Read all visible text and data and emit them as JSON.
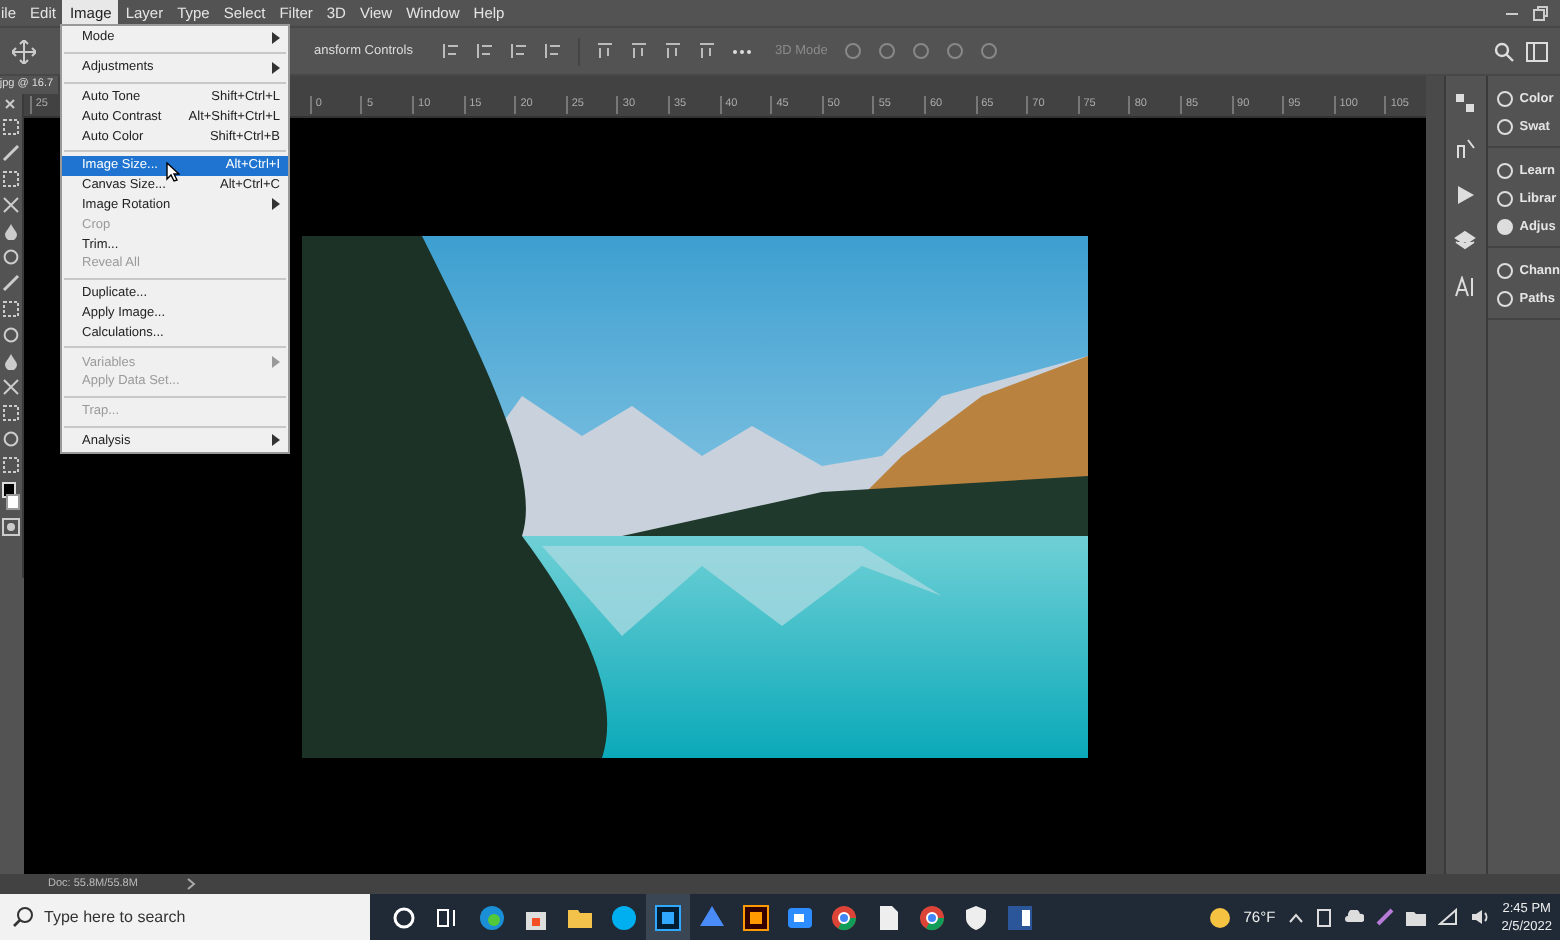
{
  "menubar": [
    {
      "label": "ile",
      "selected": false
    },
    {
      "label": "Edit",
      "selected": false
    },
    {
      "label": "Image",
      "selected": true
    },
    {
      "label": "Layer",
      "selected": false
    },
    {
      "label": "Type",
      "selected": false
    },
    {
      "label": "Select",
      "selected": false
    },
    {
      "label": "Filter",
      "selected": false
    },
    {
      "label": "3D",
      "selected": false
    },
    {
      "label": "View",
      "selected": false
    },
    {
      "label": "Window",
      "selected": false
    },
    {
      "label": "Help",
      "selected": false
    }
  ],
  "options_bar": {
    "transform_label": "ansform Controls",
    "mode_label": "3D Mode"
  },
  "document_tab": {
    "title": "jpg @ 16.7"
  },
  "ruler": {
    "left_tick": "25",
    "ticks": [
      "0",
      "5",
      "10",
      "15",
      "20",
      "25",
      "30",
      "35",
      "40",
      "45",
      "50",
      "55",
      "60",
      "65",
      "70",
      "75",
      "80",
      "85",
      "90",
      "95",
      "100",
      "105"
    ]
  },
  "image_menu": [
    [
      {
        "label": "Mode",
        "submenu": true,
        "disabled": false,
        "selected": false
      }
    ],
    [
      {
        "label": "Adjustments",
        "submenu": true,
        "disabled": false,
        "selected": false
      }
    ],
    [
      {
        "label": "Auto Tone",
        "shortcut": "Shift+Ctrl+L",
        "submenu": false,
        "disabled": false,
        "selected": false
      },
      {
        "label": "Auto Contrast",
        "shortcut": "Alt+Shift+Ctrl+L",
        "submenu": false,
        "disabled": false,
        "selected": false
      },
      {
        "label": "Auto Color",
        "shortcut": "Shift+Ctrl+B",
        "submenu": false,
        "disabled": false,
        "selected": false
      }
    ],
    [
      {
        "label": "Image Size...",
        "shortcut": "Alt+Ctrl+I",
        "submenu": false,
        "disabled": false,
        "selected": true
      },
      {
        "label": "Canvas Size...",
        "shortcut": "Alt+Ctrl+C",
        "submenu": false,
        "disabled": false,
        "selected": false
      },
      {
        "label": "Image Rotation",
        "submenu": true,
        "disabled": false,
        "selected": false
      },
      {
        "label": "Crop",
        "submenu": false,
        "disabled": true,
        "selected": false
      },
      {
        "label": "Trim...",
        "submenu": false,
        "disabled": false,
        "selected": false
      },
      {
        "label": "Reveal All",
        "submenu": false,
        "disabled": true,
        "selected": false
      }
    ],
    [
      {
        "label": "Duplicate...",
        "submenu": false,
        "disabled": false,
        "selected": false
      },
      {
        "label": "Apply Image...",
        "submenu": false,
        "disabled": false,
        "selected": false
      },
      {
        "label": "Calculations...",
        "submenu": false,
        "disabled": false,
        "selected": false
      }
    ],
    [
      {
        "label": "Variables",
        "submenu": true,
        "disabled": true,
        "selected": false
      },
      {
        "label": "Apply Data Set...",
        "submenu": false,
        "disabled": true,
        "selected": false
      }
    ],
    [
      {
        "label": "Trap...",
        "submenu": false,
        "disabled": true,
        "selected": false
      }
    ],
    [
      {
        "label": "Analysis",
        "submenu": true,
        "disabled": false,
        "selected": false
      }
    ]
  ],
  "panels": [
    {
      "group": [
        {
          "label": "Color"
        },
        {
          "label": "Swat"
        }
      ]
    },
    {
      "group": [
        {
          "label": "Learn"
        },
        {
          "label": "Librar"
        },
        {
          "label": "Adjus"
        }
      ]
    },
    {
      "group": [
        {
          "label": "Chann"
        },
        {
          "label": "Paths"
        }
      ]
    }
  ],
  "status_bar": {
    "doc_size": "Doc: 55.8M/55.8M"
  },
  "taskbar": {
    "search_placeholder": "Type here to search",
    "weather": "76°F",
    "time": "2:45 PM",
    "date": "2/5/2022"
  }
}
